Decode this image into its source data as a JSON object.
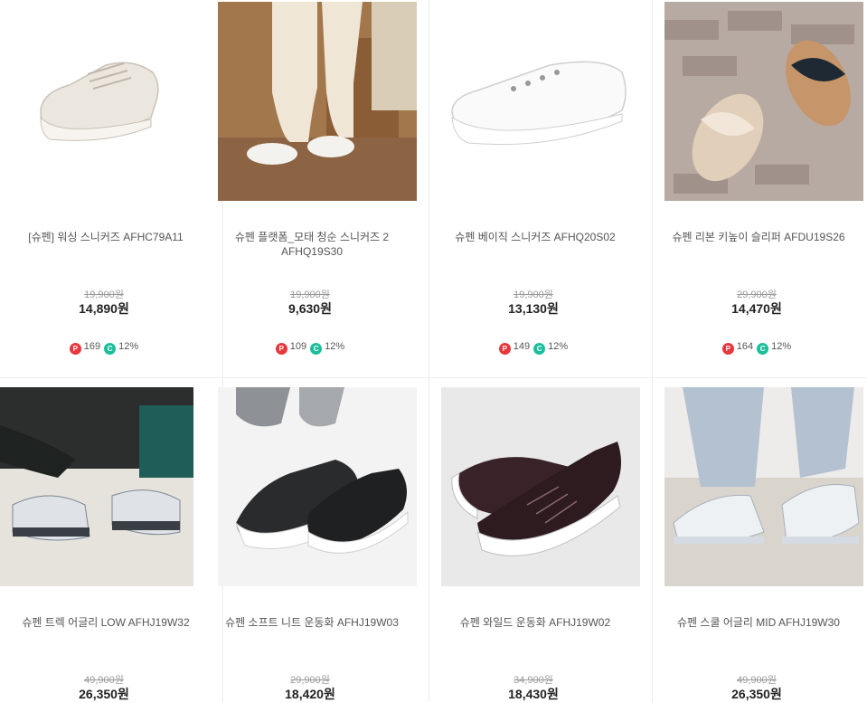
{
  "products": [
    {
      "name": "[슈펜] 워싱 스니커즈 AFHC79A11",
      "original_price": "19,900원",
      "sale_price": "14,890원",
      "points": "169",
      "discount": "12%",
      "image": "cream-sneaker"
    },
    {
      "name": "슈펜 플랫폼_모태 청순 스니커즈 2 AFHQ19S30",
      "original_price": "19,900원",
      "sale_price": "9,630원",
      "points": "109",
      "discount": "12%",
      "image": "worn-white-sneakers"
    },
    {
      "name": "슈펜 베이직 스니커즈 AFHQ20S02",
      "original_price": "19,900원",
      "sale_price": "13,130원",
      "points": "149",
      "discount": "12%",
      "image": "white-canvas-sneaker"
    },
    {
      "name": "슈펜 리본 키높이 슬리퍼 AFDU19S26",
      "original_price": "29,900원",
      "sale_price": "14,470원",
      "points": "164",
      "discount": "12%",
      "image": "ribbon-slippers"
    },
    {
      "name": "슈펜 트렉 어글리 LOW AFHJ19W32",
      "original_price": "49,900원",
      "sale_price": "26,350원",
      "points": "",
      "discount": "",
      "image": "ugly-sneakers-worn"
    },
    {
      "name": "슈펜 소프트 니트 운동화 AFHJ19W03",
      "original_price": "29,900원",
      "sale_price": "18,420원",
      "points": "",
      "discount": "",
      "image": "black-knit-sneakers"
    },
    {
      "name": "슈펜 와일드 운동화 AFHJ19W02",
      "original_price": "34,900원",
      "sale_price": "18,430원",
      "points": "",
      "discount": "",
      "image": "burgundy-running-shoes"
    },
    {
      "name": "슈펜 스쿨 어글리 MID AFHJ19W30",
      "original_price": "49,900원",
      "sale_price": "26,350원",
      "points": "",
      "discount": "",
      "image": "white-chunky-sneakers"
    }
  ],
  "badges": {
    "point_label": "P",
    "coupon_label": "C"
  },
  "colors": {
    "point_badge": "#e8363c",
    "coupon_badge": "#1bbf9b"
  }
}
